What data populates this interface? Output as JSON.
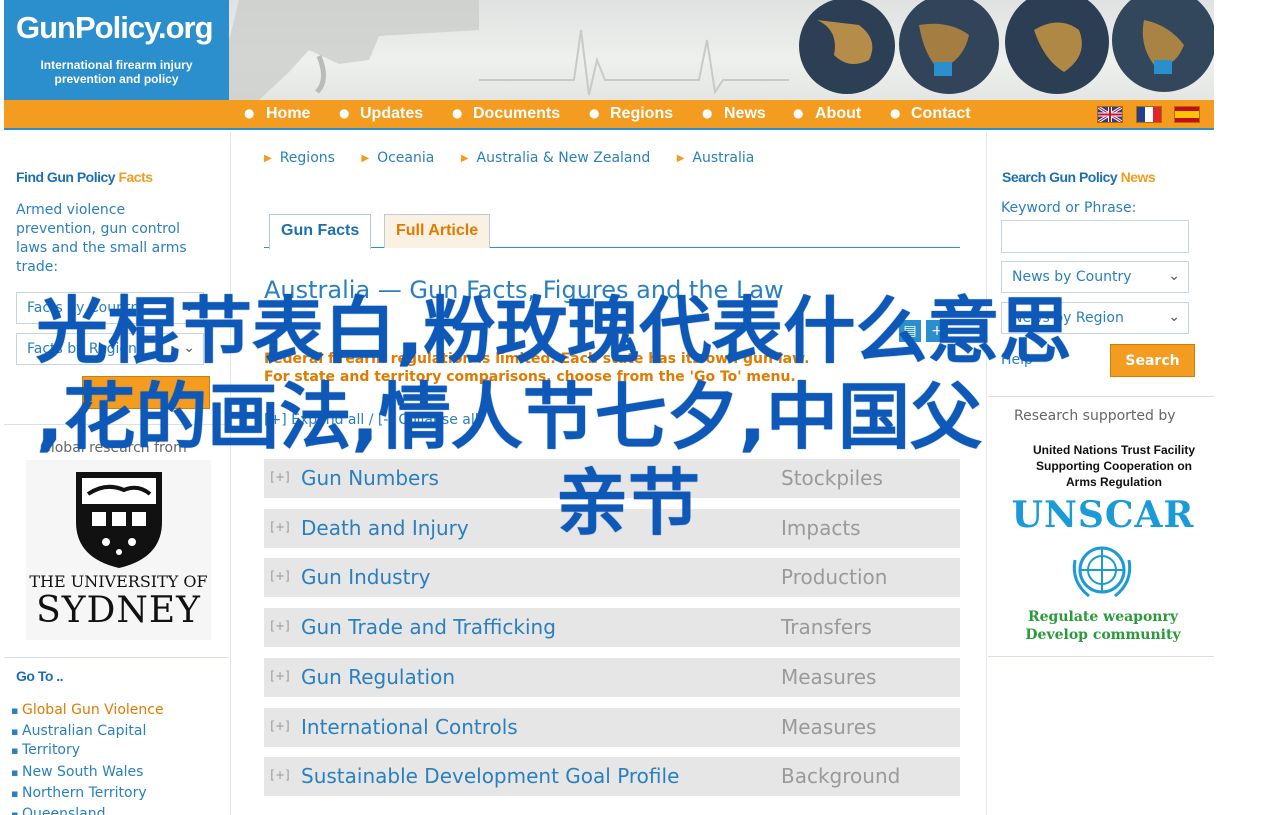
{
  "header": {
    "logo_title": "GunPolicy.org",
    "logo_subtitle_line1": "International firearm injury",
    "logo_subtitle_line2": "prevention and policy"
  },
  "nav": {
    "items": [
      "Home",
      "Updates",
      "Documents",
      "Regions",
      "News",
      "About",
      "Contact"
    ],
    "flags": [
      "uk-flag",
      "france-flag",
      "spain-flag"
    ],
    "accent": "#f39c1f",
    "brand_blue": "#2a8fcc"
  },
  "left_sidebar": {
    "find_title_main": "Find Gun Policy ",
    "find_title_accent": "Facts",
    "intro_line1": "Armed violence",
    "intro_line2": "prevention, gun control",
    "intro_line3": "laws and the small arms",
    "intro_line4": "trade:",
    "facts_by_country": "Facts by Country",
    "facts_by_region": "Facts by Region",
    "global_research": "Global research from",
    "university_line1": "THE UNIVERSITY OF",
    "university_line2": "SYDNEY",
    "goto_title": "Go To ..",
    "goto_items": [
      "Global Gun Violence",
      "Australian Capital",
      "Territory",
      "New South Wales",
      "Northern Territory",
      "Queensland"
    ]
  },
  "main": {
    "breadcrumb": [
      "Regions",
      "Oceania",
      "Australia & New Zealand",
      "Australia"
    ],
    "tabs": [
      "Gun Facts",
      "Full Article"
    ],
    "title": "Australia — Gun Facts, Figures and the Law",
    "notice_line1": "Federal firearm regulation is limited. Each state has its own gun law.",
    "notice_line2": "For state and territory comparisons, choose from the 'Go To' menu.",
    "expand_all": "[+] Expand all / [-] Collapse all",
    "rows": [
      {
        "label": "Gun Numbers",
        "category": "Stockpiles"
      },
      {
        "label": "Death and Injury",
        "category": "Impacts"
      },
      {
        "label": "Gun Industry",
        "category": "Production"
      },
      {
        "label": "Gun Trade and Trafficking",
        "category": "Transfers"
      },
      {
        "label": "Gun Regulation",
        "category": "Measures"
      },
      {
        "label": "International Controls",
        "category": "Measures"
      },
      {
        "label": "Sustainable Development Goal Profile",
        "category": "Background"
      }
    ],
    "row_expand_symbol": "[+]"
  },
  "right_sidebar": {
    "search_title_main": "Search Gun Policy ",
    "search_title_accent": "News",
    "keyword_label": "Keyword or Phrase:",
    "keyword_value": "",
    "news_by_country": "News by Country",
    "news_by_region": "News by Region",
    "help_label": "Help",
    "search_button": "Search",
    "supported_by": "Research supported by",
    "unscar_line1": "United Nations Trust Facility",
    "unscar_line2": "Supporting Cooperation on",
    "unscar_line3": "Arms Regulation",
    "unscar_logo": "UNSCAR",
    "unscar_tag1": "Regulate weaponry",
    "unscar_tag2": "Develop community"
  },
  "overlay": {
    "line1": "光棍节表白,粉玫瑰代表什么意思",
    "line2": ",花的画法,情人节七夕,中国父",
    "line3": "亲节"
  }
}
